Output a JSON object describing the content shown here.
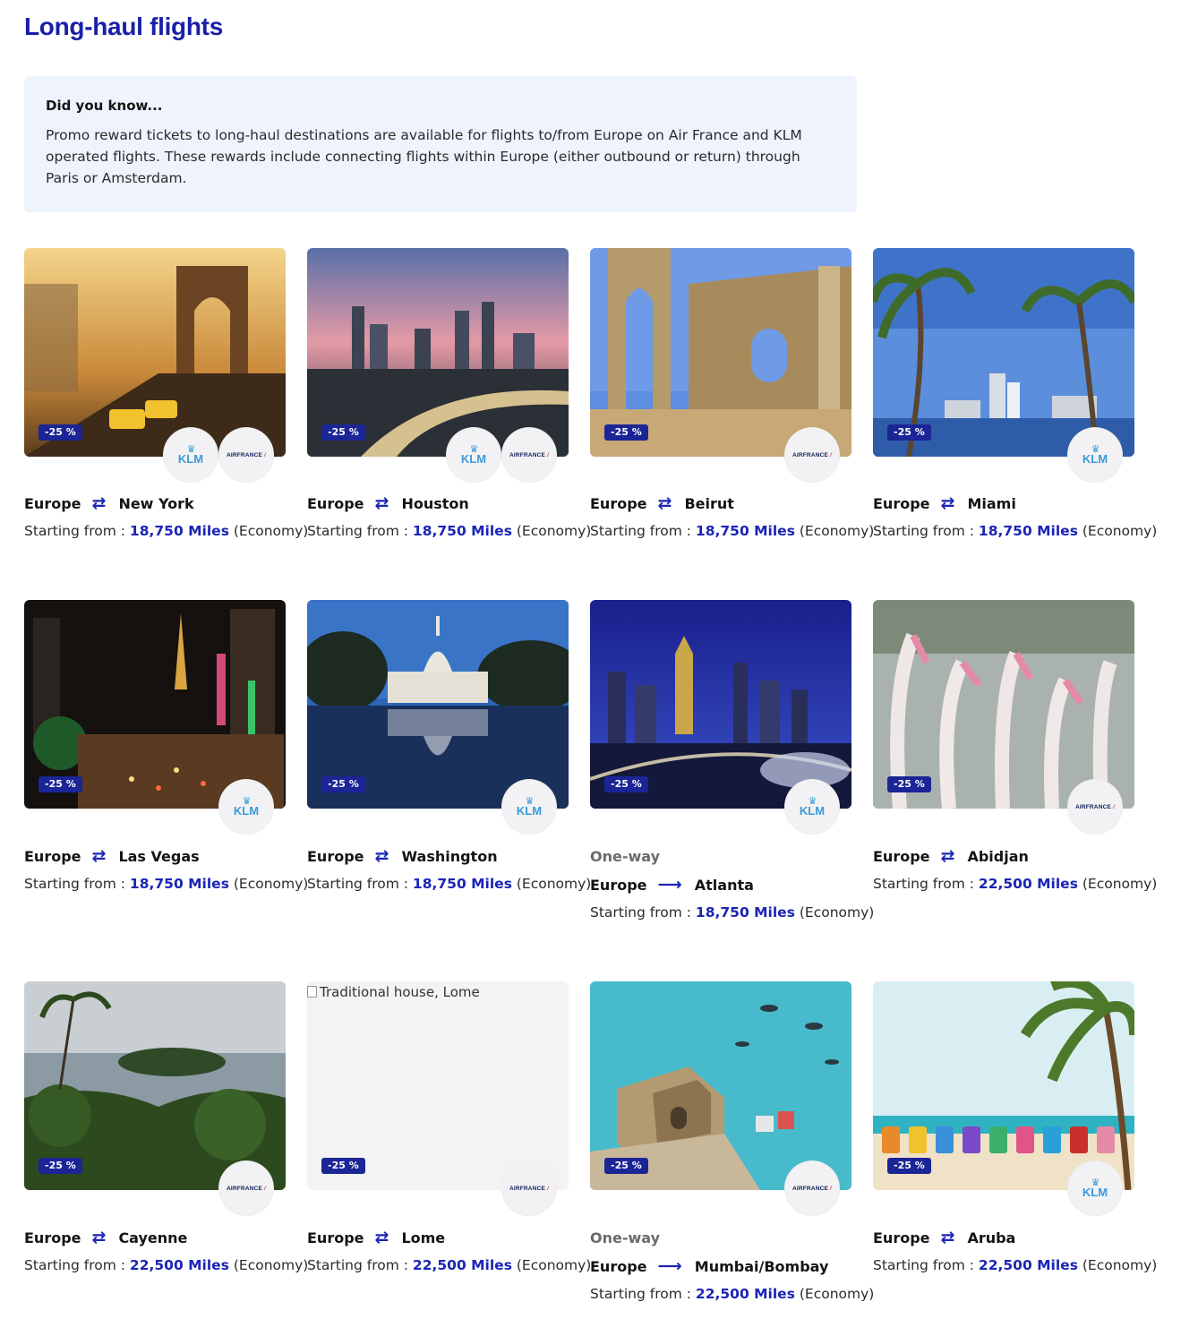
{
  "title": "Long-haul flights",
  "info": {
    "heading": "Did you know...",
    "body": "Promo reward tickets to long-haul destinations are available for flights to/from Europe on Air France and KLM operated flights. These rewards include connecting flights within Europe (either outbound or return) through Paris or Amsterdam."
  },
  "common": {
    "origin": "Europe",
    "starting_from": "Starting from : ",
    "cabin": "(Economy)",
    "badge": "-25 %",
    "one_way_label": "One-way",
    "klm": "KLM",
    "airfrance": "AIRFRANCE"
  },
  "cards": [
    {
      "destination": "New York",
      "miles": "18,750 Miles",
      "one_way": false,
      "airlines": [
        "klm",
        "airfrance"
      ]
    },
    {
      "destination": "Houston",
      "miles": "18,750 Miles",
      "one_way": false,
      "airlines": [
        "klm",
        "airfrance"
      ]
    },
    {
      "destination": "Beirut",
      "miles": "18,750 Miles",
      "one_way": false,
      "airlines": [
        "airfrance"
      ]
    },
    {
      "destination": "Miami",
      "miles": "18,750 Miles",
      "one_way": false,
      "airlines": [
        "klm"
      ]
    },
    {
      "destination": "Las Vegas",
      "miles": "18,750 Miles",
      "one_way": false,
      "airlines": [
        "klm"
      ]
    },
    {
      "destination": "Washington",
      "miles": "18,750 Miles",
      "one_way": false,
      "airlines": [
        "klm"
      ]
    },
    {
      "destination": "Atlanta",
      "miles": "18,750 Miles",
      "one_way": true,
      "airlines": [
        "klm"
      ]
    },
    {
      "destination": "Abidjan",
      "miles": "22,500 Miles",
      "one_way": false,
      "airlines": [
        "airfrance"
      ]
    },
    {
      "destination": "Cayenne",
      "miles": "22,500 Miles",
      "one_way": false,
      "airlines": [
        "airfrance"
      ]
    },
    {
      "destination": "Lome",
      "miles": "22,500 Miles",
      "one_way": false,
      "airlines": [
        "airfrance"
      ],
      "image_alt": "Traditional house, Lome"
    },
    {
      "destination": "Mumbai/Bombay",
      "miles": "22,500 Miles",
      "one_way": true,
      "airlines": [
        "airfrance"
      ]
    },
    {
      "destination": "Aruba",
      "miles": "22,500 Miles",
      "one_way": false,
      "airlines": [
        "klm"
      ]
    }
  ]
}
